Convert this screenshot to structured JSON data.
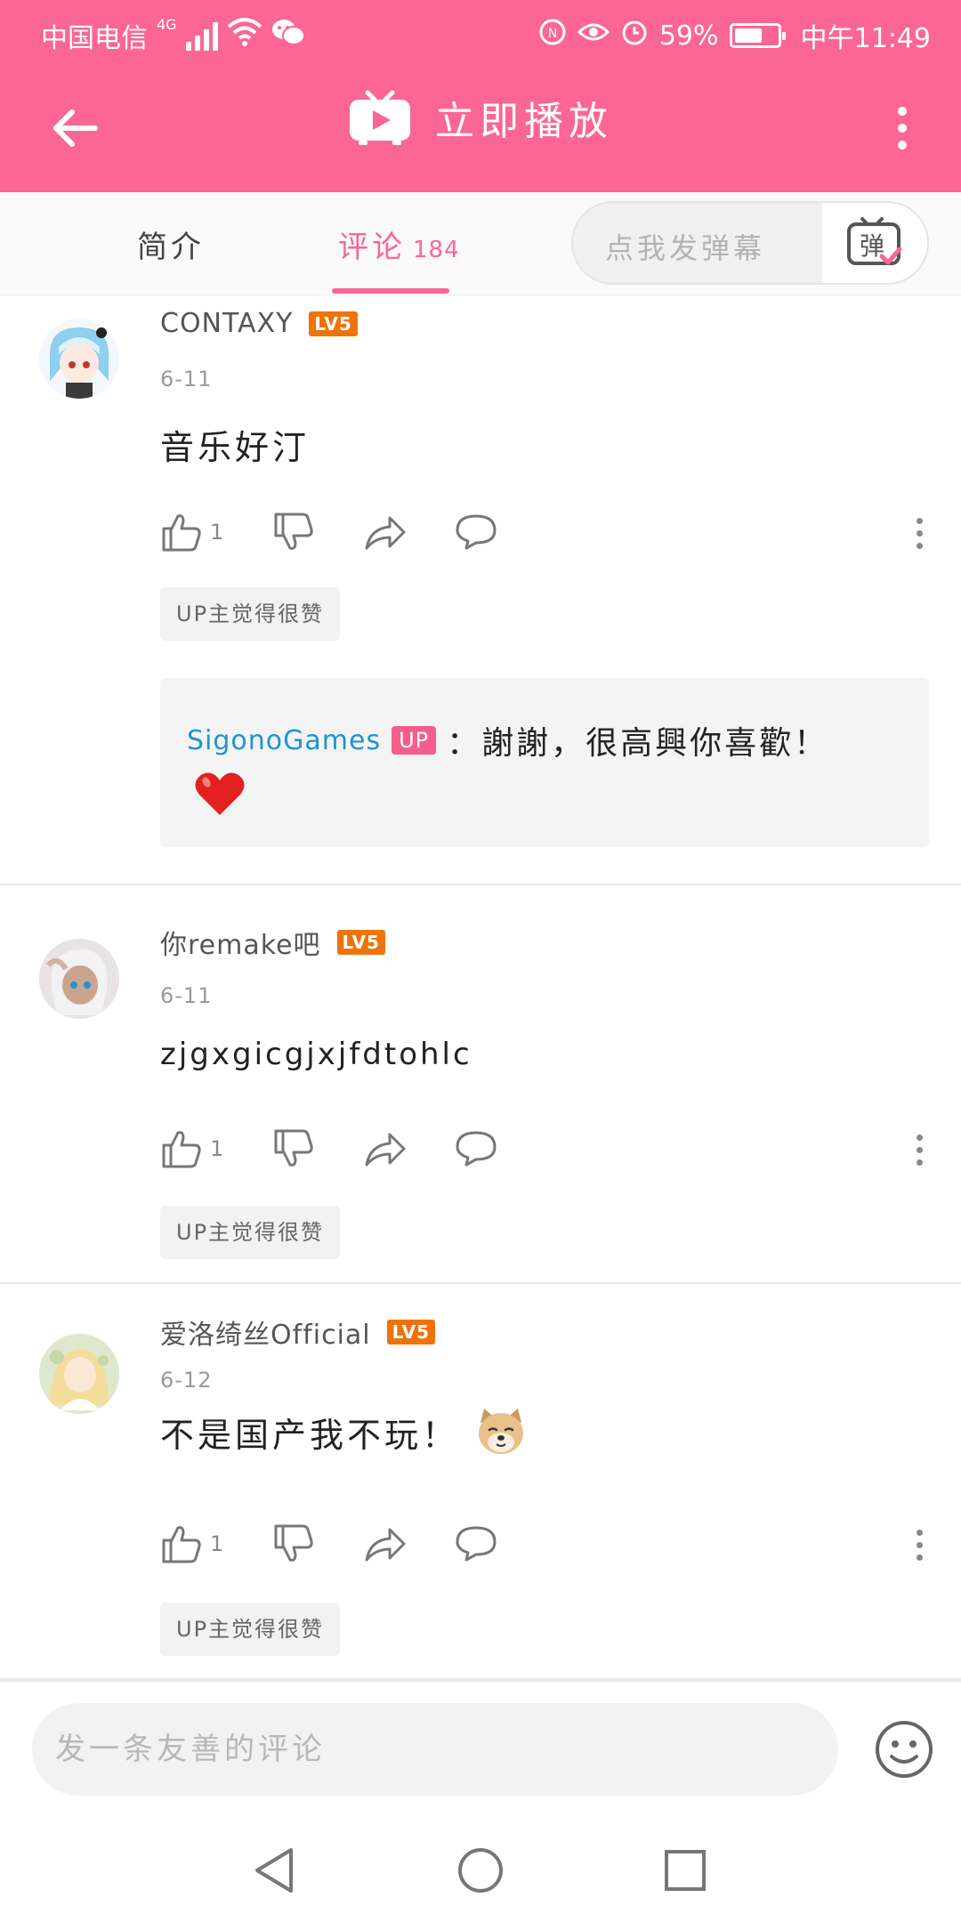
{
  "status_bar": {
    "carrier": "中国电信",
    "network": "4G",
    "battery_text": "59%",
    "battery_level": 0.59,
    "time": "中午11:49"
  },
  "header": {
    "title": "立即播放",
    "accent_color": "#fb6694"
  },
  "tabs": {
    "intro_label": "简介",
    "comments_label": "评论",
    "comments_count": "184"
  },
  "danmaku": {
    "placeholder": "点我发弹幕",
    "button_label": "弹"
  },
  "comments": [
    {
      "username": "CONTAXY",
      "level": "LV5",
      "date": "6-11",
      "text": "音乐好汀",
      "like_count": "1",
      "up_like_label": "UP主觉得很赞",
      "reply": {
        "username": "SigonoGames",
        "badge": "UP",
        "separator": "：",
        "text": "謝謝，很高興你喜歡！",
        "emoji": "heart-emoji"
      }
    },
    {
      "username": "你remake吧",
      "level": "LV5",
      "date": "6-11",
      "text": "zjgxgicgjxjfdtohlc",
      "like_count": "1",
      "up_like_label": "UP主觉得很赞"
    },
    {
      "username": "爱洛绮丝Official",
      "level": "LV5",
      "date": "6-12",
      "text": "不是国产我不玩！",
      "emoji": "dog-face-emoji",
      "like_count": "1",
      "up_like_label": "UP主觉得很赞"
    }
  ],
  "comment_input": {
    "placeholder": "发一条友善的评论"
  }
}
